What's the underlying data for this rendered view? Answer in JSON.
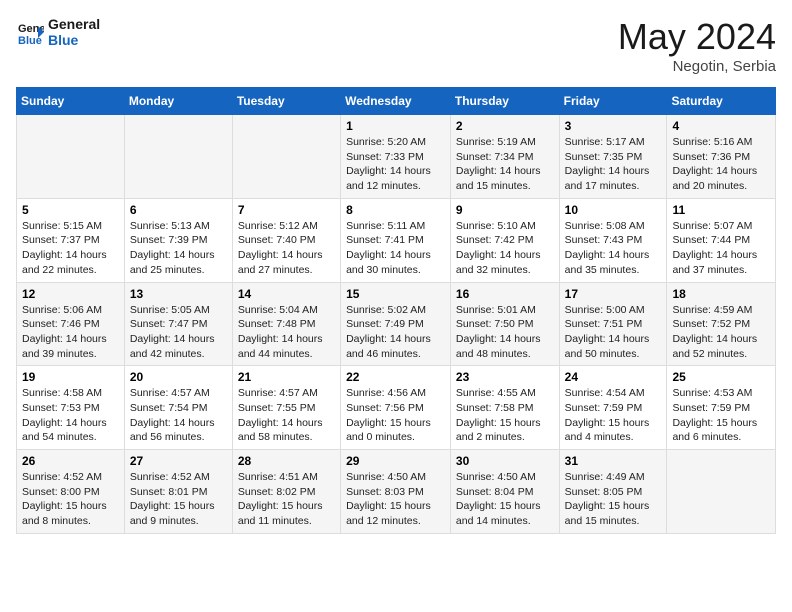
{
  "header": {
    "logo_line1": "General",
    "logo_line2": "Blue",
    "month": "May 2024",
    "location": "Negotin, Serbia"
  },
  "weekdays": [
    "Sunday",
    "Monday",
    "Tuesday",
    "Wednesday",
    "Thursday",
    "Friday",
    "Saturday"
  ],
  "weeks": [
    [
      {
        "day": "",
        "text": ""
      },
      {
        "day": "",
        "text": ""
      },
      {
        "day": "",
        "text": ""
      },
      {
        "day": "1",
        "text": "Sunrise: 5:20 AM\nSunset: 7:33 PM\nDaylight: 14 hours\nand 12 minutes."
      },
      {
        "day": "2",
        "text": "Sunrise: 5:19 AM\nSunset: 7:34 PM\nDaylight: 14 hours\nand 15 minutes."
      },
      {
        "day": "3",
        "text": "Sunrise: 5:17 AM\nSunset: 7:35 PM\nDaylight: 14 hours\nand 17 minutes."
      },
      {
        "day": "4",
        "text": "Sunrise: 5:16 AM\nSunset: 7:36 PM\nDaylight: 14 hours\nand 20 minutes."
      }
    ],
    [
      {
        "day": "5",
        "text": "Sunrise: 5:15 AM\nSunset: 7:37 PM\nDaylight: 14 hours\nand 22 minutes."
      },
      {
        "day": "6",
        "text": "Sunrise: 5:13 AM\nSunset: 7:39 PM\nDaylight: 14 hours\nand 25 minutes."
      },
      {
        "day": "7",
        "text": "Sunrise: 5:12 AM\nSunset: 7:40 PM\nDaylight: 14 hours\nand 27 minutes."
      },
      {
        "day": "8",
        "text": "Sunrise: 5:11 AM\nSunset: 7:41 PM\nDaylight: 14 hours\nand 30 minutes."
      },
      {
        "day": "9",
        "text": "Sunrise: 5:10 AM\nSunset: 7:42 PM\nDaylight: 14 hours\nand 32 minutes."
      },
      {
        "day": "10",
        "text": "Sunrise: 5:08 AM\nSunset: 7:43 PM\nDaylight: 14 hours\nand 35 minutes."
      },
      {
        "day": "11",
        "text": "Sunrise: 5:07 AM\nSunset: 7:44 PM\nDaylight: 14 hours\nand 37 minutes."
      }
    ],
    [
      {
        "day": "12",
        "text": "Sunrise: 5:06 AM\nSunset: 7:46 PM\nDaylight: 14 hours\nand 39 minutes."
      },
      {
        "day": "13",
        "text": "Sunrise: 5:05 AM\nSunset: 7:47 PM\nDaylight: 14 hours\nand 42 minutes."
      },
      {
        "day": "14",
        "text": "Sunrise: 5:04 AM\nSunset: 7:48 PM\nDaylight: 14 hours\nand 44 minutes."
      },
      {
        "day": "15",
        "text": "Sunrise: 5:02 AM\nSunset: 7:49 PM\nDaylight: 14 hours\nand 46 minutes."
      },
      {
        "day": "16",
        "text": "Sunrise: 5:01 AM\nSunset: 7:50 PM\nDaylight: 14 hours\nand 48 minutes."
      },
      {
        "day": "17",
        "text": "Sunrise: 5:00 AM\nSunset: 7:51 PM\nDaylight: 14 hours\nand 50 minutes."
      },
      {
        "day": "18",
        "text": "Sunrise: 4:59 AM\nSunset: 7:52 PM\nDaylight: 14 hours\nand 52 minutes."
      }
    ],
    [
      {
        "day": "19",
        "text": "Sunrise: 4:58 AM\nSunset: 7:53 PM\nDaylight: 14 hours\nand 54 minutes."
      },
      {
        "day": "20",
        "text": "Sunrise: 4:57 AM\nSunset: 7:54 PM\nDaylight: 14 hours\nand 56 minutes."
      },
      {
        "day": "21",
        "text": "Sunrise: 4:57 AM\nSunset: 7:55 PM\nDaylight: 14 hours\nand 58 minutes."
      },
      {
        "day": "22",
        "text": "Sunrise: 4:56 AM\nSunset: 7:56 PM\nDaylight: 15 hours\nand 0 minutes."
      },
      {
        "day": "23",
        "text": "Sunrise: 4:55 AM\nSunset: 7:58 PM\nDaylight: 15 hours\nand 2 minutes."
      },
      {
        "day": "24",
        "text": "Sunrise: 4:54 AM\nSunset: 7:59 PM\nDaylight: 15 hours\nand 4 minutes."
      },
      {
        "day": "25",
        "text": "Sunrise: 4:53 AM\nSunset: 7:59 PM\nDaylight: 15 hours\nand 6 minutes."
      }
    ],
    [
      {
        "day": "26",
        "text": "Sunrise: 4:52 AM\nSunset: 8:00 PM\nDaylight: 15 hours\nand 8 minutes."
      },
      {
        "day": "27",
        "text": "Sunrise: 4:52 AM\nSunset: 8:01 PM\nDaylight: 15 hours\nand 9 minutes."
      },
      {
        "day": "28",
        "text": "Sunrise: 4:51 AM\nSunset: 8:02 PM\nDaylight: 15 hours\nand 11 minutes."
      },
      {
        "day": "29",
        "text": "Sunrise: 4:50 AM\nSunset: 8:03 PM\nDaylight: 15 hours\nand 12 minutes."
      },
      {
        "day": "30",
        "text": "Sunrise: 4:50 AM\nSunset: 8:04 PM\nDaylight: 15 hours\nand 14 minutes."
      },
      {
        "day": "31",
        "text": "Sunrise: 4:49 AM\nSunset: 8:05 PM\nDaylight: 15 hours\nand 15 minutes."
      },
      {
        "day": "",
        "text": ""
      }
    ]
  ]
}
